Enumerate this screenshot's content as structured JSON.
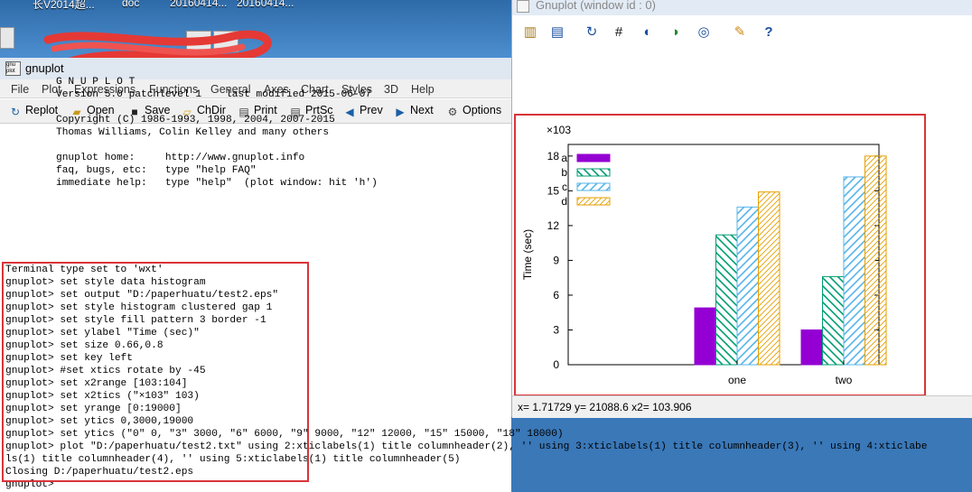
{
  "desktop": {
    "labels": [
      "长V2014超...",
      "doc",
      "20160414...",
      "20160414..."
    ]
  },
  "console": {
    "title": "gnuplot",
    "icon_text": "gnu plot",
    "menu": [
      "File",
      "Plot",
      "Expressions",
      "Functions",
      "General",
      "Axes",
      "Chart",
      "Styles",
      "3D",
      "Help"
    ],
    "toolbar": [
      {
        "label": "Replot",
        "icon": "replot-icon"
      },
      {
        "label": "Open",
        "icon": "open-folder-icon"
      },
      {
        "label": "Save",
        "icon": "save-disk-icon"
      },
      {
        "label": "ChDir",
        "icon": "change-dir-icon"
      },
      {
        "label": "Print",
        "icon": "printer-icon"
      },
      {
        "label": "PrtSc",
        "icon": "print-screen-icon"
      },
      {
        "label": "Prev",
        "icon": "prev-arrow-icon"
      },
      {
        "label": "Next",
        "icon": "next-arrow-icon"
      },
      {
        "label": "Options",
        "icon": "options-gear-icon"
      }
    ],
    "banner": [
      "G N U P L O T",
      "Version 5.0 patchlevel 1    last modified 2015-06-07",
      "",
      "Copyright (C) 1986-1993, 1998, 2004, 2007-2015",
      "Thomas Williams, Colin Kelley and many others",
      "",
      "gnuplot home:     http://www.gnuplot.info",
      "faq, bugs, etc:   type \"help FAQ\"",
      "immediate help:   type \"help\"  (plot window: hit 'h')"
    ],
    "session": [
      "Terminal type set to 'wxt'",
      "gnuplot> set style data histogram",
      "gnuplot> set output \"D:/paperhuatu/test2.eps\"",
      "gnuplot> set style histogram clustered gap 1",
      "gnuplot> set style fill pattern 3 border -1",
      "gnuplot> set ylabel \"Time (sec)\"",
      "gnuplot> set size 0.66,0.8",
      "gnuplot> set key left",
      "gnuplot> #set xtics rotate by -45",
      "gnuplot> set x2range [103:104]",
      "gnuplot> set x2tics (\"×103\" 103)",
      "gnuplot> set yrange [0:19000]",
      "gnuplot> set ytics 0,3000,19000",
      "gnuplot> set ytics (\"0\" 0, \"3\" 3000, \"6\" 6000, \"9\" 9000, \"12\" 12000, \"15\" 15000, \"18\" 18000)",
      "gnuplot> plot \"D:/paperhuatu/test2.txt\" using 2:xticlabels(1) title columnheader(2), '' using 3:xticlabels(1) title columnheader(3), '' using 4:xticlabe",
      "ls(1) title columnheader(4), '' using 5:xticlabels(1) title columnheader(5)",
      "Closing D:/paperhuatu/test2.eps",
      "gnuplot> "
    ]
  },
  "plot_window": {
    "title": "Gnuplot (window id : 0)",
    "toolbar_icons": [
      "copy-clipboard-icon",
      "print-icon",
      "replot-icon",
      "grid-icon",
      "zoom-prev-icon",
      "zoom-next-icon",
      "autoscale-icon",
      "config-wrench-icon",
      "help-icon"
    ],
    "status": "x= 1.71729 y= 21088.6 x2= 103.906"
  },
  "chart_data": {
    "type": "bar",
    "categories": [
      "one",
      "two"
    ],
    "series": [
      {
        "name": "a",
        "values": [
          4900,
          3000
        ],
        "color": "#9400d3",
        "pattern": "solid"
      },
      {
        "name": "b",
        "values": [
          11200,
          7600
        ],
        "color": "#009e73",
        "pattern": "diag-back"
      },
      {
        "name": "c",
        "values": [
          13600,
          16200
        ],
        "color": "#56b4e9",
        "pattern": "diag-fwd"
      },
      {
        "name": "d",
        "values": [
          14900,
          18000
        ],
        "color": "#e69f00",
        "pattern": "diag-fine"
      }
    ],
    "ylabel": "Time (sec)",
    "ylim": [
      0,
      19000
    ],
    "yticks": [
      {
        "label": "0",
        "value": 0
      },
      {
        "label": "3",
        "value": 3000
      },
      {
        "label": "6",
        "value": 6000
      },
      {
        "label": "9",
        "value": 9000
      },
      {
        "label": "12",
        "value": 12000
      },
      {
        "label": "15",
        "value": 15000
      },
      {
        "label": "18",
        "value": 18000
      }
    ],
    "x2tick_label": "×103",
    "legend_position": "top-left",
    "grid": false
  }
}
